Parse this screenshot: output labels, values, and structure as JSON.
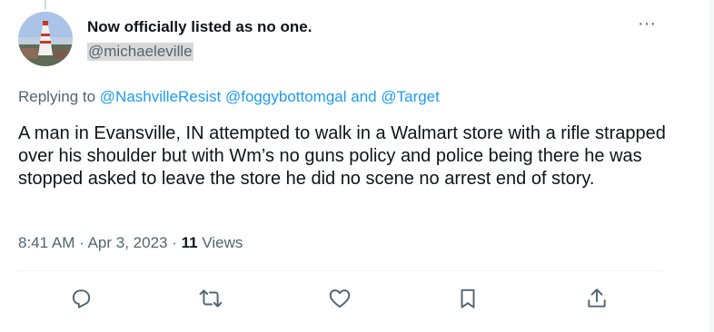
{
  "tweet": {
    "author_name": "Now officially listed as no one.",
    "author_handle": "@michaeleville",
    "replying_prefix": "Replying to",
    "replying_user1": "@NashvilleResist",
    "replying_user2": "@foggybottomgal",
    "replying_and": "and",
    "replying_user3": "@Target",
    "body": "A man in Evansville, IN attempted to walk in a Walmart store with a rifle strapped over his shoulder but with Wm’s no guns policy and police being there he was stopped asked to leave the store he did no scene no arrest end of story.",
    "time": "8:41 AM",
    "dot1": "·",
    "date": "Apr 3, 2023",
    "dot2": "·",
    "views_count": "11",
    "views_label": "Views",
    "more_label": "···"
  },
  "actions": {
    "reply_icon": "reply-icon",
    "retweet_icon": "retweet-icon",
    "like_icon": "like-icon",
    "bookmark_icon": "bookmark-icon",
    "share_icon": "share-icon"
  },
  "colors": {
    "link": "#1d9bf0",
    "secondary_text": "#536471",
    "primary_text": "#0f1419"
  }
}
